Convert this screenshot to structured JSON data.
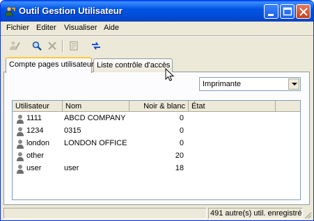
{
  "window": {
    "title": "Outil Gestion Utilisateur",
    "app_icon": "user-key-icon",
    "controls": [
      "minimize-icon",
      "maximize-icon",
      "close-icon"
    ]
  },
  "menu": {
    "items": [
      {
        "label": "Fichier"
      },
      {
        "label": "Editer"
      },
      {
        "label": "Visualiser"
      },
      {
        "label": "Aide"
      }
    ]
  },
  "toolbar": {
    "buttons": [
      {
        "icon": "edit-user-icon",
        "enabled": false
      },
      {
        "icon": "search-icon",
        "enabled": true
      },
      {
        "icon": "delete-icon",
        "enabled": false
      },
      {
        "icon": "properties-icon",
        "enabled": false
      },
      {
        "icon": "refresh-icon",
        "enabled": true
      }
    ]
  },
  "tabs": [
    {
      "label": "Compte pages utilisateur",
      "active": true
    },
    {
      "label": "Liste contrôle d'accès",
      "active": false
    }
  ],
  "printer_select": {
    "value": "Imprimante",
    "icon": "chevron-down-icon"
  },
  "table": {
    "columns": [
      "Utilisateur",
      "Nom",
      "Noir & blanc",
      "État"
    ],
    "rows": [
      {
        "user": "1111",
        "name": "ABCD COMPANY",
        "bw": "0",
        "state": ""
      },
      {
        "user": "1234",
        "name": "0315",
        "bw": "0",
        "state": ""
      },
      {
        "user": "london",
        "name": "LONDON OFFICE",
        "bw": "0",
        "state": ""
      },
      {
        "user": "other",
        "name": "",
        "bw": "20",
        "state": ""
      },
      {
        "user": "user",
        "name": "user",
        "bw": "18",
        "state": ""
      }
    ],
    "row_icon": "user-icon"
  },
  "statusbar": {
    "text": "491 autre(s) util. enregistré(s)"
  },
  "colors": {
    "titlebar": "#0054e3",
    "face": "#ece9d8",
    "tab_highlight": "#ffc83c"
  }
}
